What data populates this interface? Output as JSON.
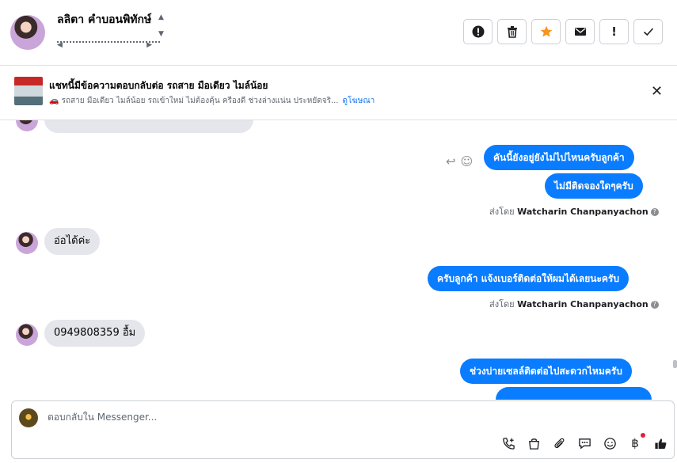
{
  "header": {
    "contact_name": "ลลิตา คำบอนพิทักษ์",
    "actions": [
      {
        "name": "spam-button",
        "glyph": "!"
      },
      {
        "name": "delete-button",
        "glyph": ""
      },
      {
        "name": "star-button",
        "glyph": ""
      },
      {
        "name": "mark-unread-button",
        "glyph": ""
      },
      {
        "name": "follow-up-button",
        "glyph": "!"
      },
      {
        "name": "done-button",
        "glyph": ""
      }
    ]
  },
  "ad": {
    "title": "แชทนี้มีข้อความตอบกลับต่อ รถสาย มือเดียว ไมล์น้อย",
    "description": "🚗 รถสาย มือเดียว ไมล์น้อย รถเข้าใหม่ ไม่ต้องคุ้น ครีองดี ช่วงล่างแน่น ประหยัดจริ...",
    "link": "ดูโฆษณา"
  },
  "thread": {
    "messages_in": [
      {
        "text": "0949808359  อื้ม"
      },
      {
        "text": "อ่อได้ค่ะ"
      }
    ],
    "messages_out": [
      {
        "text": "คันนี้ยังอยู่ยังไม่ไปไหนครับลูกค้า"
      },
      {
        "text": "ไม่มีติดจองใดๆครับ"
      },
      {
        "text": "ครับลูกค้า แจ้งเบอร์ติดต่อให้ผมได้เลยนะครับ"
      },
      {
        "text": "ช่วงบ่ายเซลล์ติดต่อไปสะดวกไหมครับ"
      }
    ],
    "sent_by_prefix": "ส่งโดย",
    "sent_by_name": "Watcharin Chanpanyachon"
  },
  "composer": {
    "placeholder": "ตอบกลับใน Messenger..."
  },
  "colors": {
    "accent": "#0a7cff",
    "star": "#f7931e",
    "incoming_bubble": "#e4e6eb"
  }
}
